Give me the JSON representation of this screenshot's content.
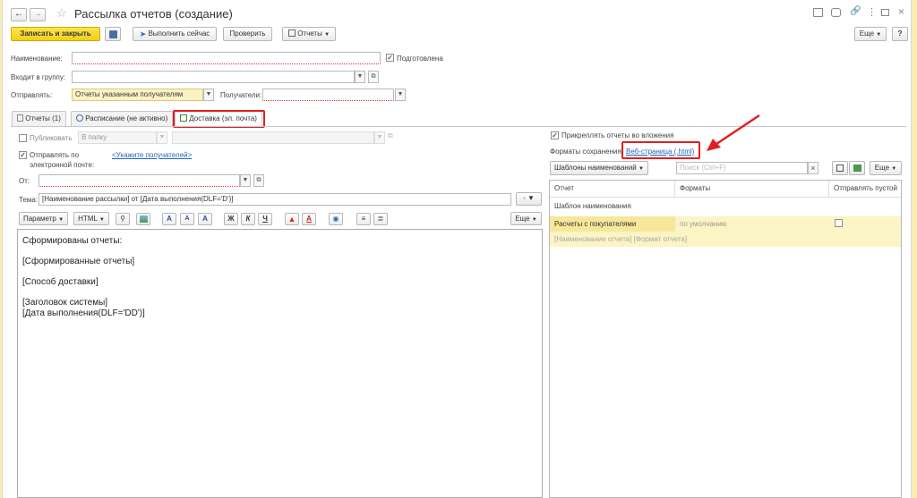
{
  "window": {
    "title": "Рассылка отчетов (создание)",
    "controls": [
      "printer-icon",
      "print-icon",
      "link-icon",
      "more-vertical-icon",
      "restore-icon",
      "close-icon"
    ]
  },
  "toolbar": {
    "save_close": "Записать и закрыть",
    "run_now": "Выполнить сейчас",
    "check": "Проверить",
    "reports": "Отчеты",
    "more": "Еще",
    "help": "?"
  },
  "form": {
    "name_label": "Наименование:",
    "name_value": "",
    "prepared_label": "Подготовлена",
    "prepared_checked": true,
    "group_label": "Входит в группу:",
    "group_value": "",
    "send_label": "Отправлять:",
    "send_value": "Отчеты указанным получателям",
    "recipients_label": "Получатели:",
    "recipients_value": ""
  },
  "tabs": [
    {
      "label": "Отчеты (1)"
    },
    {
      "label": "Расписание (не активно)"
    },
    {
      "label": "Доставка (эл. почта)"
    }
  ],
  "left": {
    "publish_label": "Публиковать",
    "publish_checked": false,
    "folder_value": "В папку",
    "send_email_label": "Отправлять по электронной почте:",
    "send_email_line1": "Отправлять по",
    "send_email_line2": "электронной почте:",
    "send_email_checked": true,
    "recipients_link": "<Укажите получателей>",
    "from_label": "От:",
    "from_value": "",
    "subject_label": "Тема:",
    "subject_value": "[Наименование рассылки] от [Дата выполнения(DLF='D')]",
    "param_btn": "Параметр",
    "html_btn": "HTML",
    "bold": "Ж",
    "italic": "К",
    "underline": "Ч",
    "font_a": "A",
    "more": "Еще",
    "editor_lines": [
      "Сформированы отчеты:",
      "",
      "[Сформированные отчеты]",
      "",
      "[Способ доставки]",
      "",
      "[Заголовок системы]",
      "[Дата выполнения(DLF='DD')]"
    ]
  },
  "right": {
    "attach_label": "Прикреплять отчеты во вложения",
    "attach_checked": true,
    "formats_label": "Форматы сохранения:",
    "formats_link": "Веб-страница (.html)",
    "templates_btn": "Шаблоны наименований",
    "search_placeholder": "Поиск (Ctrl+F)",
    "more": "Еще",
    "columns": [
      "Отчет",
      "Форматы",
      "Отправлять пустой"
    ],
    "template_label": "Шаблон наименования",
    "rows": [
      {
        "report": "Расчеты с покупателями",
        "format": "по умолчанию",
        "send_empty": false
      }
    ],
    "template_value": "[Наименование отчета] [Формат отчета]"
  },
  "colors": {
    "accent_yellow": "#f4d433",
    "highlight_red": "#e01f1f",
    "link_blue": "#2266bb",
    "row_yellow": "#fbf4c4"
  }
}
